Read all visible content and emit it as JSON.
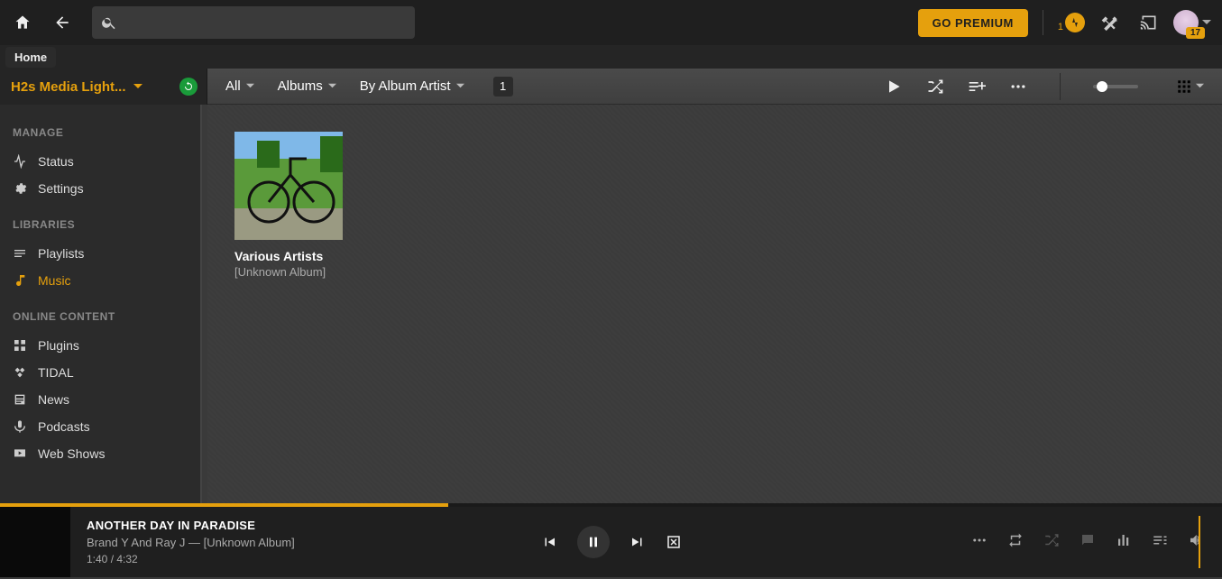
{
  "topbar": {
    "premium_label": "GO PREMIUM",
    "activity_count": "1",
    "avatar_badge": "17",
    "search_placeholder": ""
  },
  "breadcrumb": {
    "home": "Home"
  },
  "library_header": {
    "title": "H2s Media Light..."
  },
  "filters": {
    "all": "All",
    "type": "Albums",
    "sort": "By Album Artist",
    "count": "1"
  },
  "sidebar": {
    "section_manage": "MANAGE",
    "status": "Status",
    "settings": "Settings",
    "section_libraries": "LIBRARIES",
    "playlists": "Playlists",
    "music": "Music",
    "section_online": "ONLINE CONTENT",
    "plugins": "Plugins",
    "tidal": "TIDAL",
    "news": "News",
    "podcasts": "Podcasts",
    "webshows": "Web Shows"
  },
  "grid": {
    "items": [
      {
        "artist": "Various Artists",
        "album": "[Unknown Album]"
      }
    ]
  },
  "player": {
    "title": "ANOTHER DAY IN PARADISE",
    "artist": "Brand Y And Ray J",
    "sep": " — ",
    "album": "[Unknown Album]",
    "elapsed": "1:40",
    "time_sep": " / ",
    "total": "4:32",
    "progress_percent": 36.7
  }
}
